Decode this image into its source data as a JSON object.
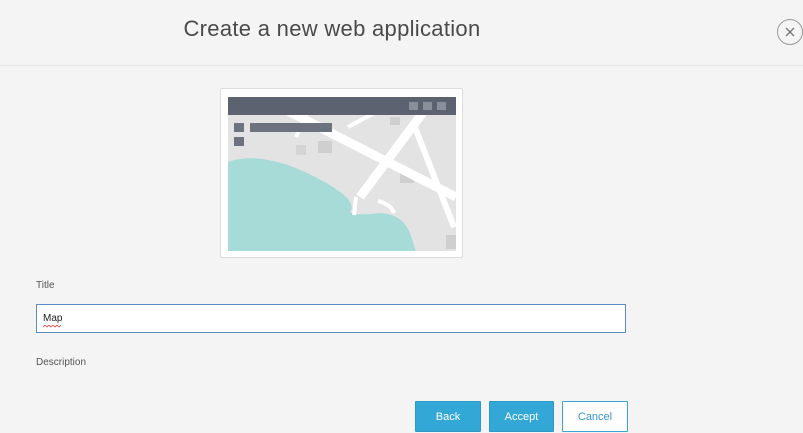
{
  "dialog": {
    "title": "Create a new web application"
  },
  "form": {
    "title_label": "Title",
    "title_value": "Map",
    "description_label": "Description"
  },
  "buttons": {
    "back": "Back",
    "accept": "Accept",
    "cancel": "Cancel"
  },
  "icons": {
    "close": "close-icon",
    "thumbnail": "map-app-thumbnail"
  },
  "colors": {
    "primary": "#33a8d6",
    "input_border": "#5a8ec3",
    "map_water": "#a6dbd8",
    "map_land": "#e3e3e3",
    "thumbnail_header": "#5c6270"
  }
}
